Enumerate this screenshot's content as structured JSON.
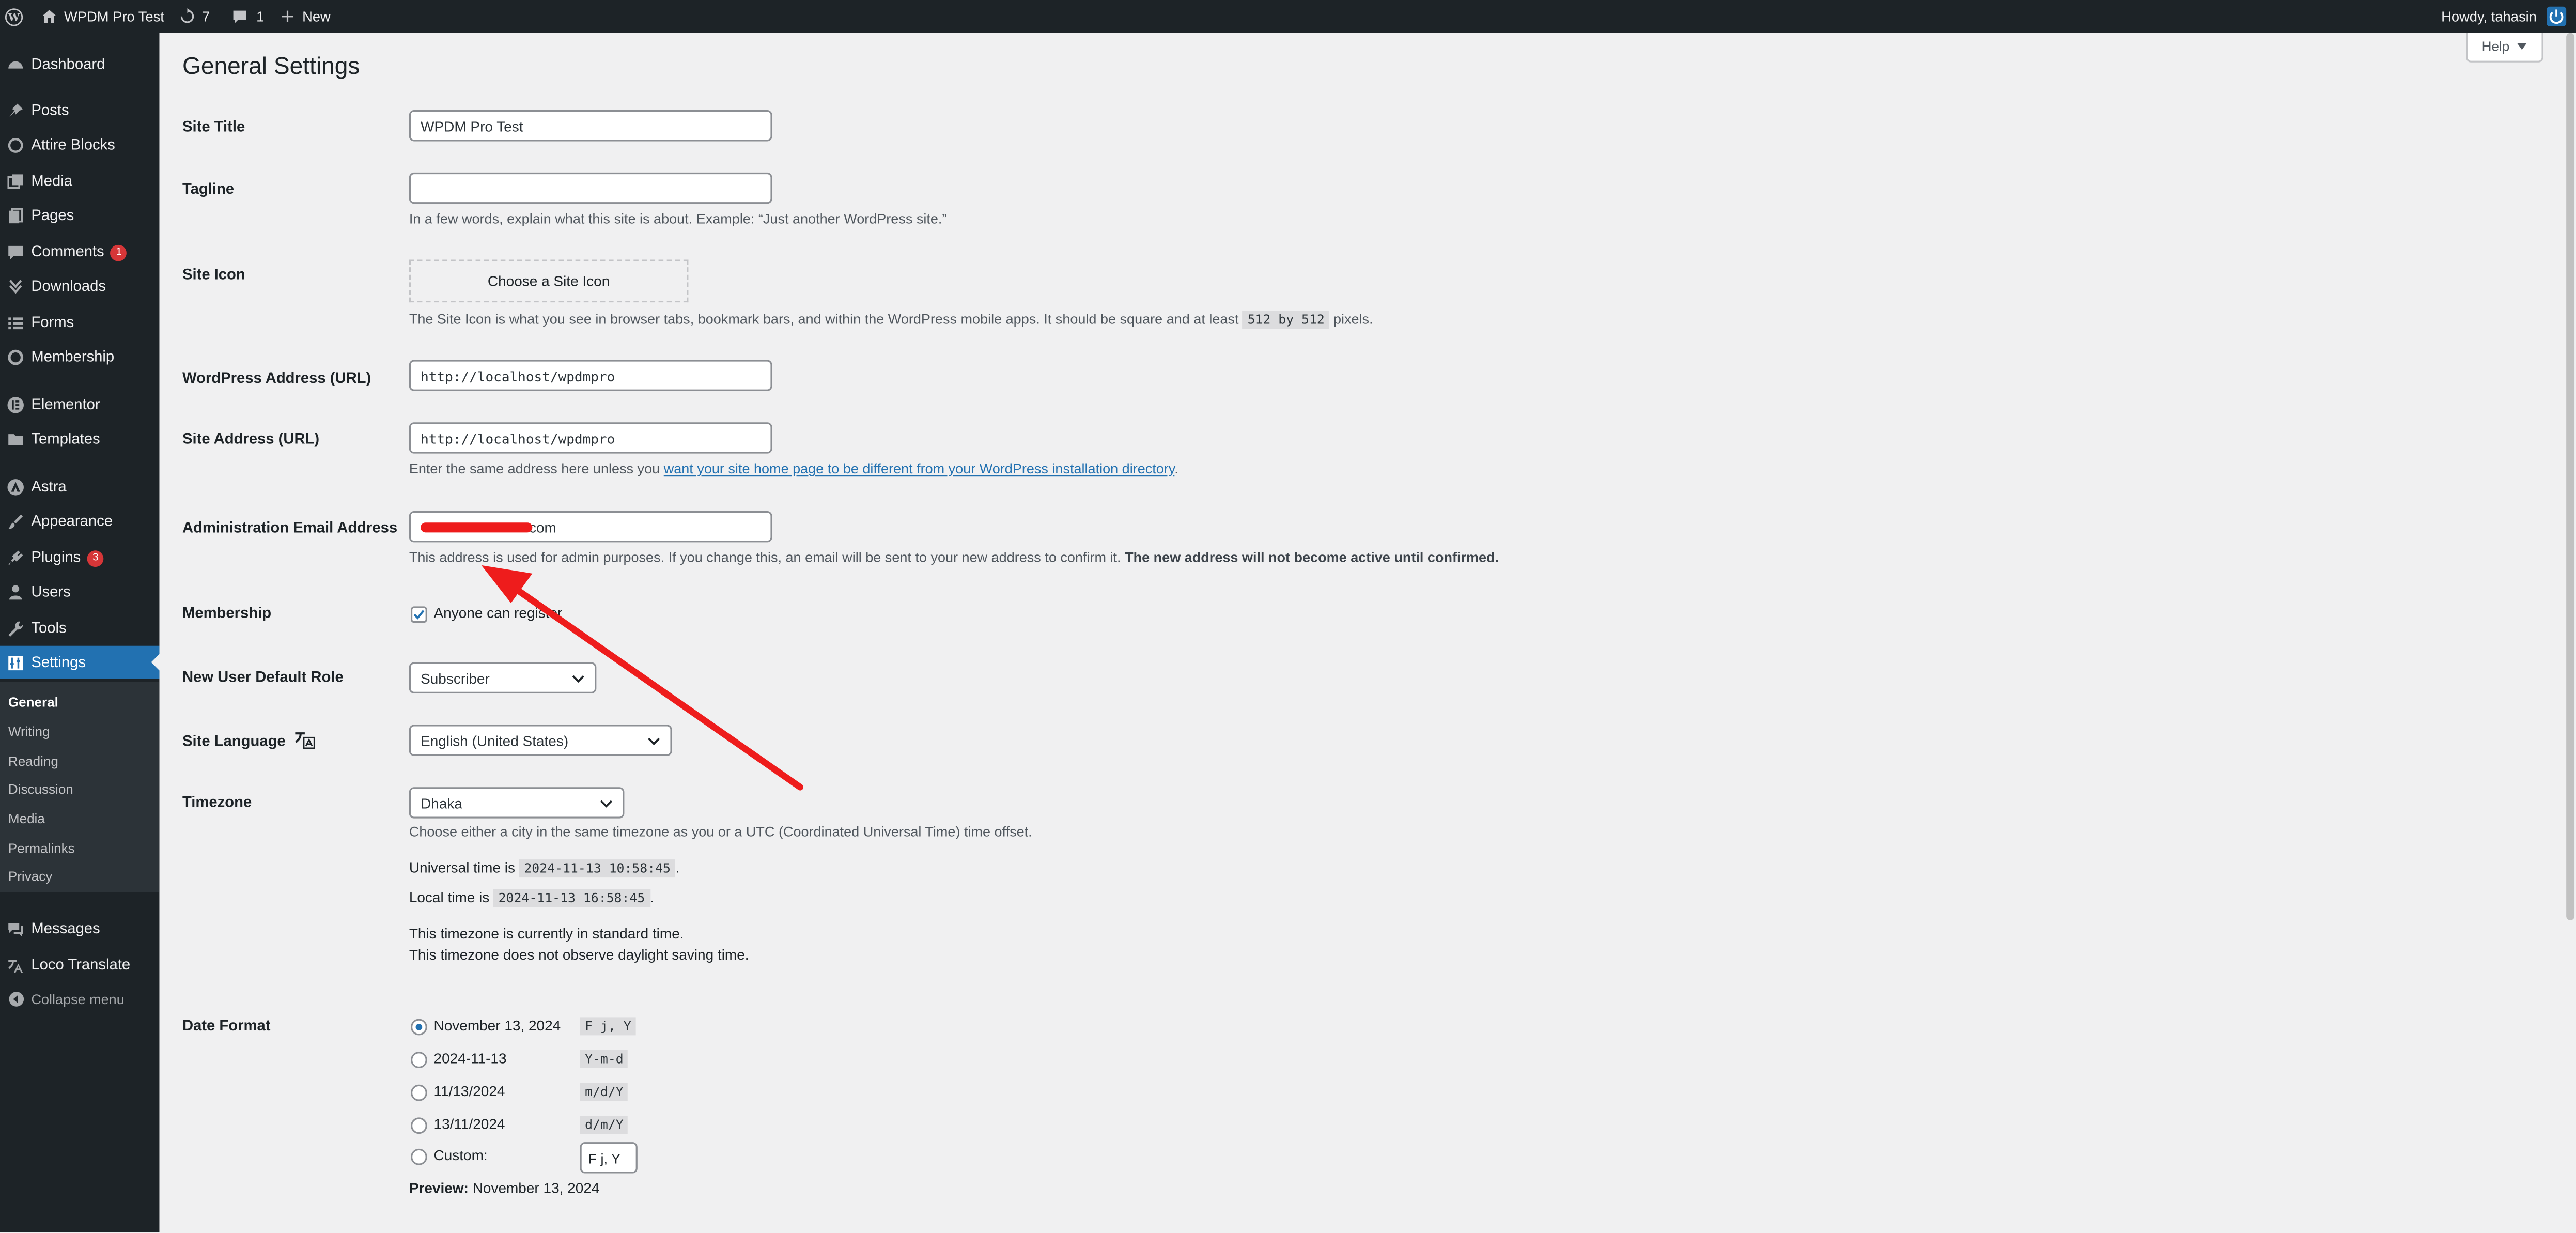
{
  "admin_bar": {
    "site_name": "WPDM Pro Test",
    "updates_count": "7",
    "comments_count": "1",
    "new_label": "New",
    "howdy": "Howdy, tahasin"
  },
  "sidebar": {
    "items": [
      {
        "label": "Dashboard",
        "icon": "dashboard-icon"
      },
      {
        "label": "Posts",
        "icon": "pin-icon"
      },
      {
        "label": "Attire Blocks",
        "icon": "blocks-icon"
      },
      {
        "label": "Media",
        "icon": "media-icon"
      },
      {
        "label": "Pages",
        "icon": "pages-icon"
      },
      {
        "label": "Comments",
        "icon": "comments-icon",
        "badge": "1"
      },
      {
        "label": "Downloads",
        "icon": "download-icon"
      },
      {
        "label": "Forms",
        "icon": "forms-icon"
      },
      {
        "label": "Membership",
        "icon": "membership-icon"
      },
      {
        "label": "Elementor",
        "icon": "elementor-icon"
      },
      {
        "label": "Templates",
        "icon": "folder-icon"
      },
      {
        "label": "Astra",
        "icon": "astra-icon"
      },
      {
        "label": "Appearance",
        "icon": "brush-icon"
      },
      {
        "label": "Plugins",
        "icon": "plugin-icon",
        "badge": "3"
      },
      {
        "label": "Users",
        "icon": "user-icon"
      },
      {
        "label": "Tools",
        "icon": "wrench-icon"
      },
      {
        "label": "Settings",
        "icon": "settings-icon"
      },
      {
        "label": "Messages",
        "icon": "messages-icon"
      },
      {
        "label": "Loco Translate",
        "icon": "translate-icon"
      },
      {
        "label": "Collapse menu",
        "icon": "collapse-icon"
      }
    ],
    "submenu": [
      "General",
      "Writing",
      "Reading",
      "Discussion",
      "Media",
      "Permalinks",
      "Privacy"
    ]
  },
  "help_label": "Help",
  "page_title": "General Settings",
  "settings": {
    "site_title_label": "Site Title",
    "site_title_value": "WPDM Pro Test",
    "tagline_label": "Tagline",
    "tagline_value": "",
    "tagline_desc": "In a few words, explain what this site is about. Example: “Just another WordPress site.”",
    "site_icon_label": "Site Icon",
    "site_icon_button": "Choose a Site Icon",
    "site_icon_desc_before": "The Site Icon is what you see in browser tabs, bookmark bars, and within the WordPress mobile apps. It should be square and at least",
    "site_icon_desc_code": "512 by 512",
    "site_icon_desc_after": "pixels.",
    "wp_address_label": "WordPress Address (URL)",
    "wp_address_value": "http://localhost/wpdmpro",
    "site_address_label": "Site Address (URL)",
    "site_address_value": "http://localhost/wpdmpro",
    "site_address_desc_before": "Enter the same address here unless you",
    "site_address_desc_link": "want your site home page to be different from your WordPress installation directory",
    "site_address_desc_after": ".",
    "admin_email_label": "Administration Email Address",
    "admin_email_value_visible": "com",
    "admin_email_desc": "This address is used for admin purposes. If you change this, an email will be sent to your new address to confirm it.",
    "admin_email_desc_bold": "The new address will not become active until confirmed.",
    "membership_label": "Membership",
    "membership_option": "Anyone can register",
    "membership_checked": true,
    "default_role_label": "New User Default Role",
    "default_role_value": "Subscriber",
    "site_language_label": "Site Language",
    "site_language_value": "English (United States)",
    "timezone_label": "Timezone",
    "timezone_value": "Dhaka",
    "timezone_desc": "Choose either a city in the same timezone as you or a UTC (Coordinated Universal Time) time offset.",
    "universal_time_label": "Universal time is",
    "universal_time_value": "2024-11-13 10:58:45",
    "local_time_label": "Local time is",
    "local_time_value": "2024-11-13 16:58:45",
    "period_1": ".",
    "period_2": ".",
    "tz_standard": "This timezone is currently in standard time.",
    "tz_no_dst": "This timezone does not observe daylight saving time.",
    "date_format_label": "Date Format",
    "date_formats": [
      {
        "label": "November 13, 2024",
        "code": "F j, Y",
        "selected": true
      },
      {
        "label": "2024-11-13",
        "code": "Y-m-d",
        "selected": false
      },
      {
        "label": "11/13/2024",
        "code": "m/d/Y",
        "selected": false
      },
      {
        "label": "13/11/2024",
        "code": "d/m/Y",
        "selected": false
      },
      {
        "label": "Custom:",
        "code": "",
        "selected": false
      }
    ],
    "custom_format_value": "F j, Y",
    "preview_label": "Preview:",
    "preview_value": "November 13, 2024"
  },
  "colors": {
    "admin_bar": "#1d2327",
    "sidebar": "#1d2327",
    "active": "#2271b1",
    "badge": "#d63638",
    "annotation_arrow": "#ee1c1c"
  }
}
